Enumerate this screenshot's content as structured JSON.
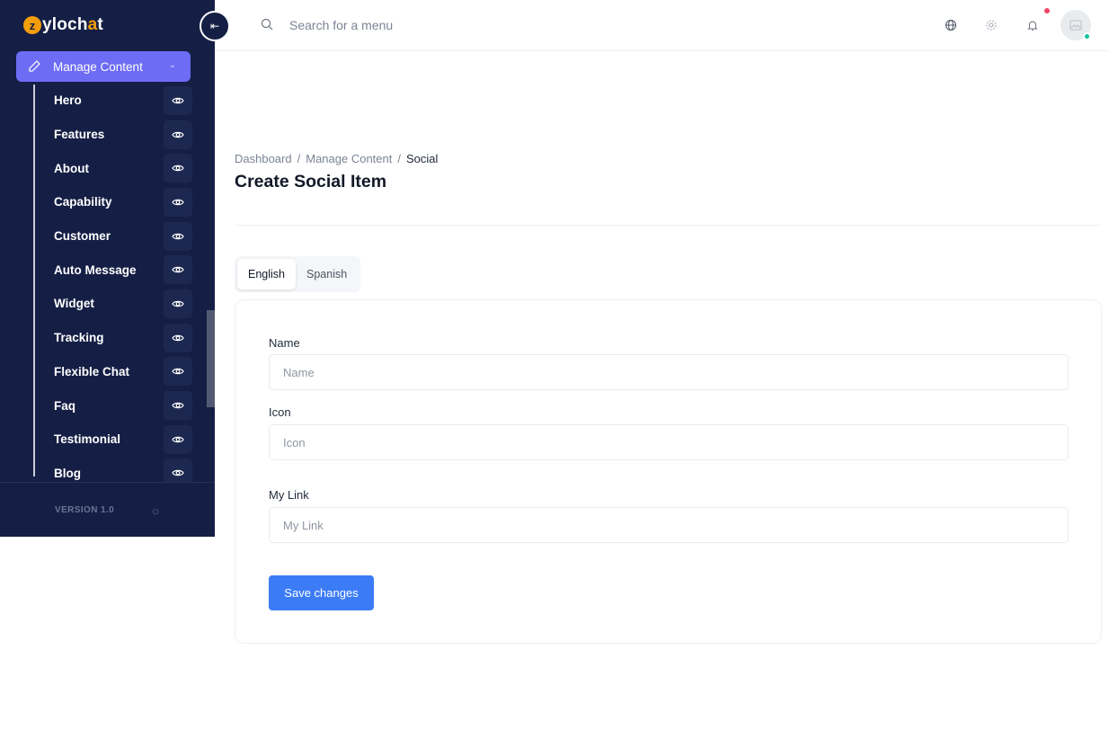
{
  "brand": {
    "logo_prefix": "z",
    "logo_text_a": "yloch",
    "logo_text_o": "a",
    "logo_text_b": "t"
  },
  "sidebar": {
    "collapse_icon": "collapse-left-icon",
    "parent": {
      "label": "Manage Content",
      "icon": "pencil-icon"
    },
    "items": [
      {
        "label": "Hero"
      },
      {
        "label": "Features"
      },
      {
        "label": "About"
      },
      {
        "label": "Capability"
      },
      {
        "label": "Customer"
      },
      {
        "label": "Auto Message"
      },
      {
        "label": "Widget"
      },
      {
        "label": "Tracking"
      },
      {
        "label": "Flexible Chat"
      },
      {
        "label": "Faq"
      },
      {
        "label": "Testimonial"
      },
      {
        "label": "Blog"
      }
    ],
    "version": "VERSION 1.0"
  },
  "header": {
    "search_placeholder": "Search for a menu",
    "icons": [
      "globe-icon",
      "gear-icon",
      "bell-icon",
      "avatar-icon"
    ]
  },
  "breadcrumb": {
    "root": "Dashboard",
    "middle": "Manage Content",
    "current": "Social"
  },
  "page": {
    "title": "Create Social Item"
  },
  "tabs": [
    {
      "label": "English",
      "active": true
    },
    {
      "label": "Spanish",
      "active": false
    }
  ],
  "form": {
    "name_label": "Name",
    "name_placeholder": "Name",
    "icon_label": "Icon",
    "icon_placeholder": "Icon",
    "link_label": "My Link",
    "link_placeholder": "My Link",
    "save_label": "Save changes"
  },
  "colors": {
    "sidebar_bg": "#151f45",
    "accent": "#6d6cf5",
    "primary_button": "#3b7cf6",
    "notif_dot": "#ef4467",
    "online_dot": "#14c39a"
  }
}
